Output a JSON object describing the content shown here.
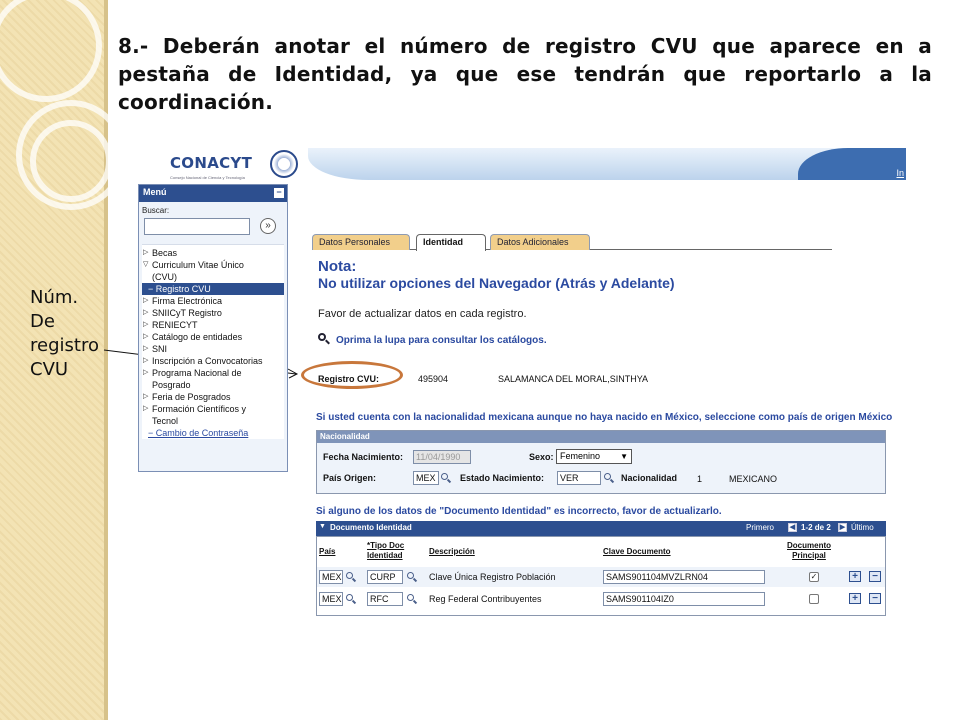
{
  "slide": {
    "title": "8.- Deberán anotar el número de registro CVU que aparece en a pestaña de Identidad, ya que ese tendrán que reportarlo a la coordinación.",
    "side_label_lines": [
      "Núm.",
      "De",
      "registro",
      "CVU"
    ]
  },
  "logo": {
    "name": "CONACYT",
    "subtitle": "Consejo Nacional de Ciencia y Tecnología"
  },
  "topbar": {
    "link": "In"
  },
  "menu": {
    "title": "Menú",
    "collapse": "−",
    "search_label": "Buscar:",
    "search_value": "",
    "go": "»",
    "items": [
      {
        "label": "Becas",
        "type": "closed"
      },
      {
        "label": "Curriculum Vitae Único",
        "type": "open"
      },
      {
        "label": "(CVU)",
        "type": "cont"
      },
      {
        "label": "− Registro CVU",
        "type": "selected"
      },
      {
        "label": "Firma Electrónica",
        "type": "closed"
      },
      {
        "label": "SNIICyT Registro",
        "type": "closed"
      },
      {
        "label": "RENIECYT",
        "type": "closed"
      },
      {
        "label": "Catálogo de entidades",
        "type": "closed"
      },
      {
        "label": "SNI",
        "type": "closed"
      },
      {
        "label": "Inscripción a Convocatorias",
        "type": "closed"
      },
      {
        "label": "Programa Nacional de",
        "type": "closed"
      },
      {
        "label": "Posgrado",
        "type": "cont"
      },
      {
        "label": "Feria de Posgrados",
        "type": "closed"
      },
      {
        "label": "Formación Científicos y",
        "type": "closed"
      },
      {
        "label": "Tecnol",
        "type": "cont"
      },
      {
        "label": "− Cambio de Contraseña",
        "type": "link"
      }
    ]
  },
  "tabs": [
    {
      "label": "Datos Personales",
      "active": false
    },
    {
      "label": "Identidad",
      "active": true
    },
    {
      "label": "Datos Adicionales",
      "active": false
    }
  ],
  "content": {
    "nota": "Nota:",
    "nota_sub": "No utilizar opciones del Navegador (Atrás y Adelante)",
    "favor": "Favor de actualizar datos en cada registro.",
    "lupa_hint": "Oprima la lupa para consultar los catálogos.",
    "registro_label": "Registro CVU:",
    "registro_value": "495904",
    "registro_name": "SALAMANCA DEL MORAL,SINTHYA",
    "hint_nacionalidad": "Si usted cuenta con la nacionalidad mexicana aunque no haya nacido en México, seleccione como país de origen México",
    "hint_documento": "Si alguno de los datos de \"Documento Identidad\" es incorrecto, favor de actualizarlo."
  },
  "nacionalidad": {
    "header": "Nacionalidad",
    "fecha_label": "Fecha Nacimiento:",
    "fecha_value": "11/04/1990",
    "sexo_label": "Sexo:",
    "sexo_value": "Femenino",
    "pais_label": "País Origen:",
    "pais_value": "MEX",
    "estado_label": "Estado Nacimiento:",
    "estado_value": "VER",
    "nac_label": "Nacionalidad",
    "nac_code": "1",
    "nac_value": "MEXICANO"
  },
  "documento": {
    "header": "Documento Identidad",
    "nav_first": "Primero",
    "nav_range": "1-2 de 2",
    "nav_last": "Último",
    "columns": [
      "País",
      "*Tipo Doc Identidad",
      "Descripción",
      "Clave Documento",
      "Documento Principal"
    ],
    "col_tipo_1": "*Tipo Doc",
    "col_tipo_2": "Identidad",
    "col_docp_1": "Documento",
    "col_docp_2": "Principal",
    "rows": [
      {
        "pais": "MEX",
        "tipo": "CURP",
        "desc": "Clave Única Registro Población",
        "clave": "SAMS901104MVZLRN04",
        "principal": "✓"
      },
      {
        "pais": "MEX",
        "tipo": "RFC",
        "desc": "Reg Federal Contribuyentes",
        "clave": "SAMS901104IZ0",
        "principal": ""
      }
    ]
  },
  "colors": {
    "accent": "#2b4aa0",
    "header": "#2d4f8f",
    "highlight": "#c8773b",
    "deco": "#f3e3b4"
  }
}
